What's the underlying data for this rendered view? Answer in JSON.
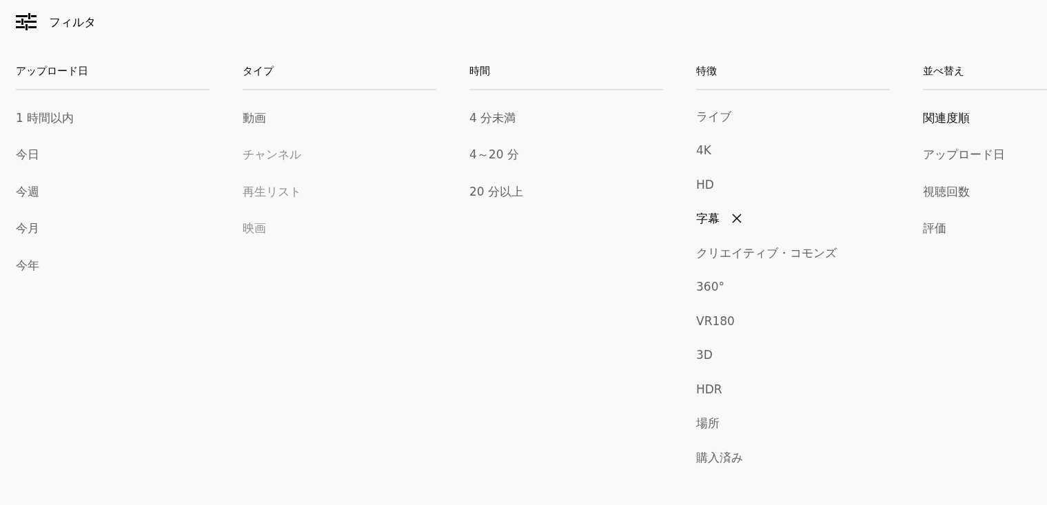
{
  "header": {
    "title": "フィルタ"
  },
  "groups": [
    {
      "kind": "filter",
      "title": "アップロード日",
      "items": [
        {
          "label": "1 時間以内",
          "selected": false,
          "disabled": false
        },
        {
          "label": "今日",
          "selected": false,
          "disabled": false
        },
        {
          "label": "今週",
          "selected": false,
          "disabled": false
        },
        {
          "label": "今月",
          "selected": false,
          "disabled": false
        },
        {
          "label": "今年",
          "selected": false,
          "disabled": false
        }
      ]
    },
    {
      "kind": "filter",
      "title": "タイプ",
      "items": [
        {
          "label": "動画",
          "selected": false,
          "disabled": false
        },
        {
          "label": "チャンネル",
          "selected": false,
          "disabled": true
        },
        {
          "label": "再生リスト",
          "selected": false,
          "disabled": true
        },
        {
          "label": "映画",
          "selected": false,
          "disabled": true
        }
      ]
    },
    {
      "kind": "filter",
      "title": "時間",
      "items": [
        {
          "label": "4 分未満",
          "selected": false,
          "disabled": false
        },
        {
          "label": "4～20 分",
          "selected": false,
          "disabled": false
        },
        {
          "label": "20 分以上",
          "selected": false,
          "disabled": false
        }
      ]
    },
    {
      "kind": "filter",
      "title": "特徴",
      "items": [
        {
          "label": "ライブ",
          "selected": false,
          "disabled": false
        },
        {
          "label": "4K",
          "selected": false,
          "disabled": false
        },
        {
          "label": "HD",
          "selected": false,
          "disabled": false
        },
        {
          "label": "字幕",
          "selected": true,
          "disabled": false
        },
        {
          "label": "クリエイティブ・コモンズ",
          "selected": false,
          "disabled": false
        },
        {
          "label": "360°",
          "selected": false,
          "disabled": false
        },
        {
          "label": "VR180",
          "selected": false,
          "disabled": false
        },
        {
          "label": "3D",
          "selected": false,
          "disabled": false
        },
        {
          "label": "HDR",
          "selected": false,
          "disabled": false
        },
        {
          "label": "場所",
          "selected": false,
          "disabled": false
        },
        {
          "label": "購入済み",
          "selected": false,
          "disabled": false
        }
      ]
    },
    {
      "kind": "sort",
      "title": "並べ替え",
      "items": [
        {
          "label": "関連度順",
          "selected": true,
          "disabled": false
        },
        {
          "label": "アップロード日",
          "selected": false,
          "disabled": false
        },
        {
          "label": "視聴回数",
          "selected": false,
          "disabled": false
        },
        {
          "label": "評価",
          "selected": false,
          "disabled": false
        }
      ]
    }
  ]
}
